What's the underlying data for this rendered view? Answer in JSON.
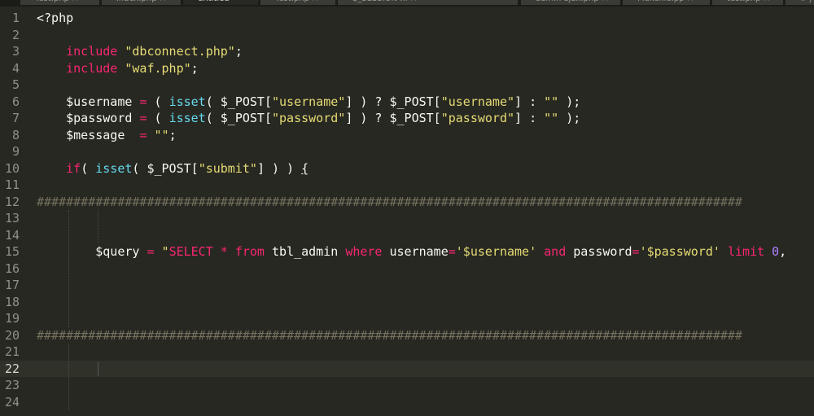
{
  "tabs": [
    {
      "label": "Test.php ×",
      "active": false
    },
    {
      "label": "index.php ×",
      "active": false
    },
    {
      "label": "untitled •",
      "active": true
    },
    {
      "label": "Test.php ×",
      "active": false
    },
    {
      "label": "$_SESSION ... ×",
      "active": false
    },
    {
      "label": "admin ajax.php ×",
      "active": false
    },
    {
      "label": "Makefile.pp ×",
      "active": false
    },
    {
      "label": "test.php ×",
      "active": false
    },
    {
      "label": "# j",
      "active": false
    }
  ],
  "editor": {
    "current_line": "22",
    "lines": [
      {
        "n": "1",
        "tokens": [
          {
            "t": "<?php",
            "c": "tag"
          }
        ]
      },
      {
        "n": "2",
        "tokens": []
      },
      {
        "n": "3",
        "tokens": [
          {
            "t": "    ",
            "c": "plain"
          },
          {
            "t": "include",
            "c": "kw"
          },
          {
            "t": " ",
            "c": "plain"
          },
          {
            "t": "\"dbconnect.php\"",
            "c": "str"
          },
          {
            "t": ";",
            "c": "plain"
          }
        ]
      },
      {
        "n": "4",
        "tokens": [
          {
            "t": "    ",
            "c": "plain"
          },
          {
            "t": "include",
            "c": "kw"
          },
          {
            "t": " ",
            "c": "plain"
          },
          {
            "t": "\"waf.php\"",
            "c": "str"
          },
          {
            "t": ";",
            "c": "plain"
          }
        ]
      },
      {
        "n": "5",
        "tokens": []
      },
      {
        "n": "6",
        "tokens": [
          {
            "t": "    $username ",
            "c": "plain"
          },
          {
            "t": "=",
            "c": "kw"
          },
          {
            "t": " ( ",
            "c": "plain"
          },
          {
            "t": "isset",
            "c": "fn"
          },
          {
            "t": "( $_POST[",
            "c": "plain"
          },
          {
            "t": "\"username\"",
            "c": "str"
          },
          {
            "t": "] ) ? $_POST[",
            "c": "plain"
          },
          {
            "t": "\"username\"",
            "c": "str"
          },
          {
            "t": "] : ",
            "c": "plain"
          },
          {
            "t": "\"\"",
            "c": "str"
          },
          {
            "t": " );",
            "c": "plain"
          }
        ]
      },
      {
        "n": "7",
        "tokens": [
          {
            "t": "    $password ",
            "c": "plain"
          },
          {
            "t": "=",
            "c": "kw"
          },
          {
            "t": " ( ",
            "c": "plain"
          },
          {
            "t": "isset",
            "c": "fn"
          },
          {
            "t": "( $_POST[",
            "c": "plain"
          },
          {
            "t": "\"password\"",
            "c": "str"
          },
          {
            "t": "] ) ? $_POST[",
            "c": "plain"
          },
          {
            "t": "\"password\"",
            "c": "str"
          },
          {
            "t": "] : ",
            "c": "plain"
          },
          {
            "t": "\"\"",
            "c": "str"
          },
          {
            "t": " );",
            "c": "plain"
          }
        ]
      },
      {
        "n": "8",
        "tokens": [
          {
            "t": "    $message  ",
            "c": "plain"
          },
          {
            "t": "=",
            "c": "kw"
          },
          {
            "t": " ",
            "c": "plain"
          },
          {
            "t": "\"\"",
            "c": "str"
          },
          {
            "t": ";",
            "c": "plain"
          }
        ]
      },
      {
        "n": "9",
        "tokens": []
      },
      {
        "n": "10",
        "tokens": [
          {
            "t": "    ",
            "c": "plain"
          },
          {
            "t": "if",
            "c": "kw"
          },
          {
            "t": "( ",
            "c": "plain"
          },
          {
            "t": "isset",
            "c": "fn"
          },
          {
            "t": "( $_POST[",
            "c": "plain"
          },
          {
            "t": "\"submit\"",
            "c": "str"
          },
          {
            "t": "] ) ) ",
            "c": "plain"
          },
          {
            "t": "{",
            "c": "plain"
          }
        ]
      },
      {
        "n": "11",
        "tokens": []
      },
      {
        "n": "12",
        "tokens": [
          {
            "t": "################################################################################################",
            "c": "cmt"
          }
        ]
      },
      {
        "n": "13",
        "tokens": []
      },
      {
        "n": "14",
        "tokens": []
      },
      {
        "n": "15",
        "tokens": [
          {
            "t": "        $query ",
            "c": "plain"
          },
          {
            "t": "=",
            "c": "kw"
          },
          {
            "t": " ",
            "c": "plain"
          },
          {
            "t": "\"",
            "c": "str"
          },
          {
            "t": "SELECT",
            "c": "kw"
          },
          {
            "t": " ",
            "c": "str"
          },
          {
            "t": "*",
            "c": "kw"
          },
          {
            "t": " ",
            "c": "str"
          },
          {
            "t": "from",
            "c": "kw"
          },
          {
            "t": " tbl_admin ",
            "c": "plain"
          },
          {
            "t": "where",
            "c": "kw"
          },
          {
            "t": " username",
            "c": "plain"
          },
          {
            "t": "=",
            "c": "kw"
          },
          {
            "t": "'$username'",
            "c": "str"
          },
          {
            "t": " ",
            "c": "plain"
          },
          {
            "t": "and",
            "c": "kw"
          },
          {
            "t": " password",
            "c": "plain"
          },
          {
            "t": "=",
            "c": "kw"
          },
          {
            "t": "'$password'",
            "c": "str"
          },
          {
            "t": " ",
            "c": "plain"
          },
          {
            "t": "limit",
            "c": "kw"
          },
          {
            "t": " ",
            "c": "plain"
          },
          {
            "t": "0",
            "c": "num"
          },
          {
            "t": ",",
            "c": "plain"
          }
        ]
      },
      {
        "n": "16",
        "tokens": []
      },
      {
        "n": "17",
        "tokens": []
      },
      {
        "n": "18",
        "tokens": []
      },
      {
        "n": "19",
        "tokens": []
      },
      {
        "n": "20",
        "tokens": [
          {
            "t": "################################################################################################",
            "c": "cmt"
          }
        ]
      },
      {
        "n": "21",
        "tokens": []
      },
      {
        "n": "22",
        "tokens": []
      },
      {
        "n": "23",
        "tokens": []
      },
      {
        "n": "24",
        "tokens": []
      }
    ]
  }
}
